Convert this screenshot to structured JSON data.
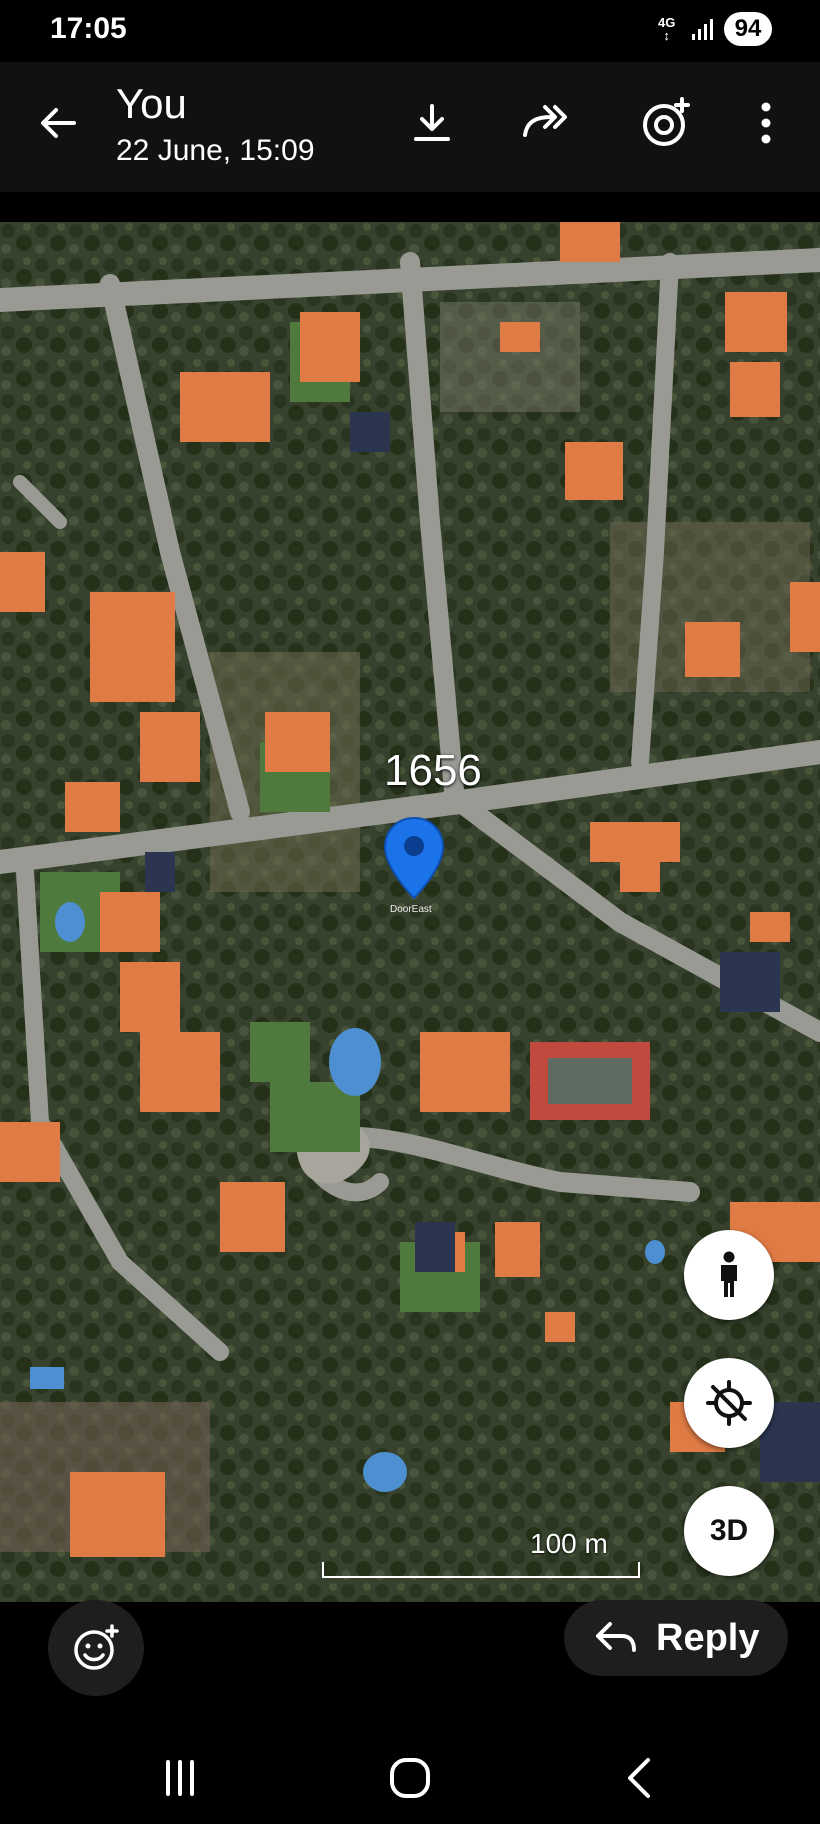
{
  "status_bar": {
    "time": "17:05",
    "network": "4G",
    "battery": "94"
  },
  "header": {
    "title": "You",
    "subtitle": "22 June, 15:09",
    "icons": [
      "back-arrow-icon",
      "download-icon",
      "forward-icon",
      "lens-icon",
      "more-icon"
    ]
  },
  "map": {
    "pin_label": "1656",
    "pin_sublabel": "DoorEast",
    "scale_label": "100 m",
    "buttons": {
      "three_d": "3D"
    },
    "colors": {
      "pin": "#1a73e8",
      "roof": "#e07b45",
      "road": "#9a9a95"
    }
  },
  "actions": {
    "reply_label": "Reply"
  }
}
